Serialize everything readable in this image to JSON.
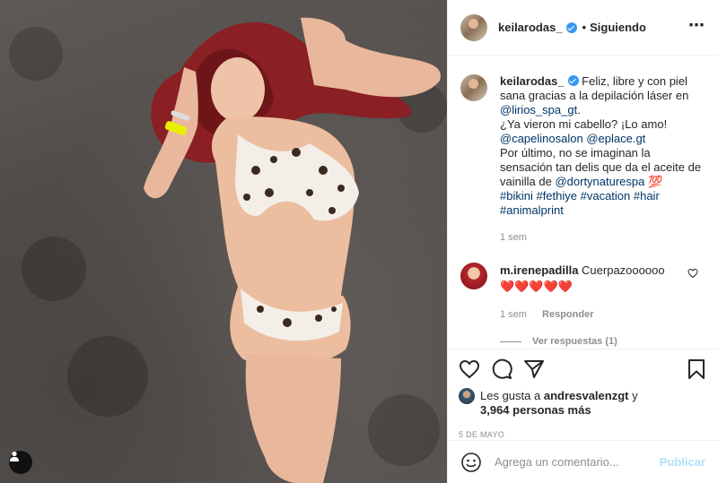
{
  "post": {
    "username": "keilarodas_",
    "follow_status": "Siguiendo",
    "separator": "•",
    "more_icon": "⋯"
  },
  "caption": {
    "username": "keilarodas_",
    "line1": "Feliz, libre y con piel sana gracias a la depilación láser en",
    "mention1": "@lirios_spa_gt",
    "line1_end": ".",
    "line2": "¿Ya vieron mi cabello? ¡Lo amo!",
    "mention2": "@capelinosalon",
    "mention3": "@eplace.gt",
    "line3": "Por último, no se imaginan la sensación tan delis que da el aceite de vainilla de",
    "mention4": "@dortynaturespa",
    "emoji": "💯",
    "hashtags": "#bikini #fethiye #vacation #hair #animalprint",
    "time": "1 sem"
  },
  "comment": {
    "username": "m.irenepadilla",
    "text": "Cuerpazoooooo",
    "hearts": "❤️❤️❤️❤️❤️",
    "time": "1 sem",
    "reply": "Responder",
    "view_replies": "Ver respuestas (1)"
  },
  "likes": {
    "prefix": "Les gusta a",
    "user": "andresvalenzgt",
    "connector": "y",
    "count": "3,964 personas más"
  },
  "date": "5 DE MAYO",
  "add_comment": {
    "placeholder": "Agrega un comentario...",
    "publish": "Publicar"
  },
  "colors": {
    "link": "#003569",
    "verified": "#3897f0",
    "muted": "#8e8e8e",
    "publish_disabled": "#b2dffc"
  }
}
